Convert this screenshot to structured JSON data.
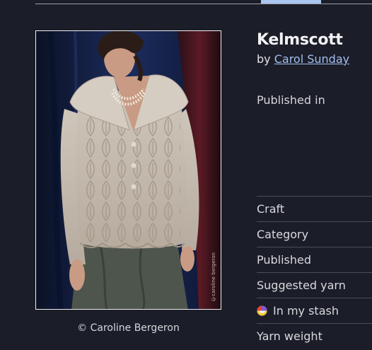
{
  "pattern": {
    "title": "Kelmscott",
    "by_prefix": "by",
    "designer": "Carol Sunday",
    "published_in": "Published in"
  },
  "photo": {
    "caption": "© Caroline Bergeron",
    "watermark": "©caroline bergeron"
  },
  "attributes": [
    {
      "label": "Craft"
    },
    {
      "label": "Category"
    },
    {
      "label": "Published"
    },
    {
      "label": "Suggested yarn"
    },
    {
      "label": "In my stash",
      "icon": "stash-icon"
    },
    {
      "label": "Yarn weight"
    }
  ],
  "colors": {
    "background": "#1b1d28",
    "link": "#a3bff0",
    "active_tab": "#a9c4ee"
  }
}
